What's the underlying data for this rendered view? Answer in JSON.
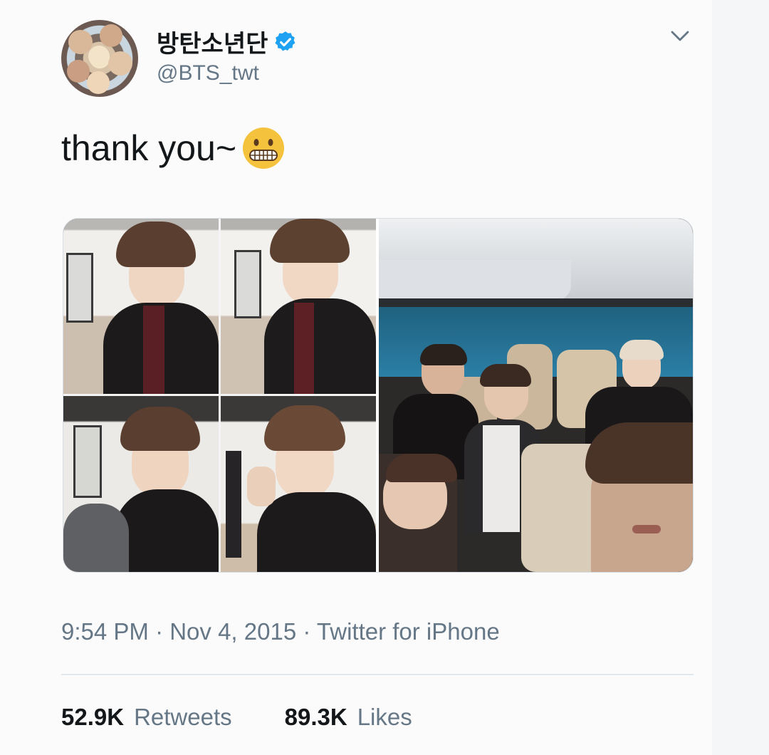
{
  "user": {
    "display_name": "방탄소년단",
    "handle": "@BTS_twt",
    "verified": true
  },
  "tweet": {
    "text": "thank you~",
    "emoji": "grimacing-face"
  },
  "meta": {
    "timestamp": "9:54 PM · Nov 4, 2015 · Twitter for iPhone"
  },
  "stats": {
    "retweets_count": "52.9K",
    "retweets_label": "Retweets",
    "likes_count": "89.3K",
    "likes_label": "Likes"
  },
  "colors": {
    "accent": "#1da1f2",
    "text": "#14171a",
    "muted": "#657786"
  }
}
